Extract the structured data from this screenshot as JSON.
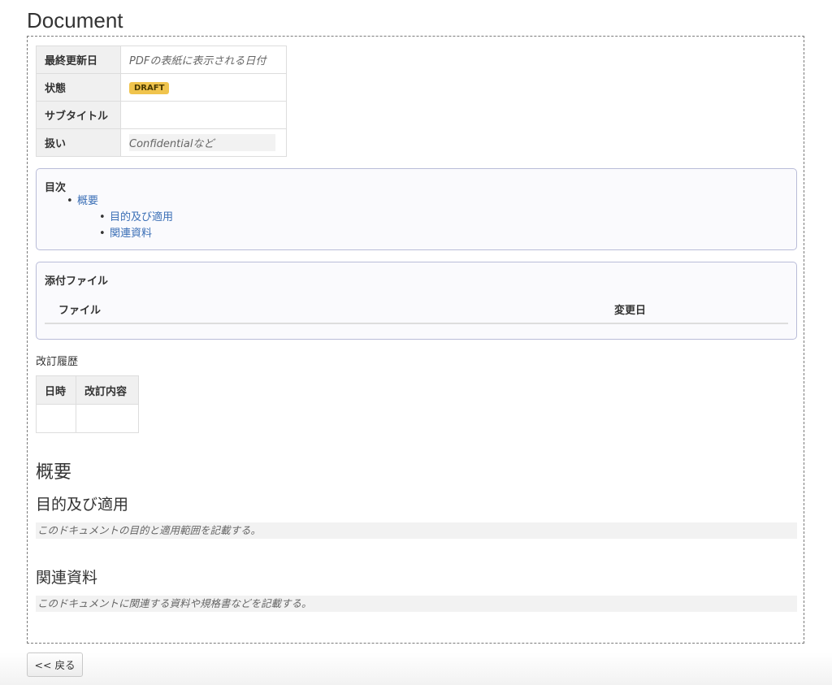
{
  "page": {
    "title": "Document"
  },
  "meta": {
    "rows": [
      {
        "key": "最終更新日",
        "value": "PDFの表紙に表示される日付"
      },
      {
        "key": "状態",
        "value": "DRAFT"
      },
      {
        "key": "サブタイトル",
        "value": ""
      },
      {
        "key": "扱い",
        "value": "Confidentialなど"
      }
    ],
    "badge_color": "#f0c44d"
  },
  "toc": {
    "title": "目次",
    "items": [
      {
        "label": "概要"
      },
      {
        "label": "目的及び適用"
      },
      {
        "label": "関連資料"
      }
    ],
    "link_color": "#3b6fb6"
  },
  "attachments": {
    "title": "添付ファイル",
    "columns": [
      "ファイル",
      "変更日"
    ]
  },
  "revision": {
    "label": "改訂履歴",
    "columns": [
      "日時",
      "改訂内容"
    ]
  },
  "sections": {
    "overview": "概要",
    "purpose": {
      "heading": "目的及び適用",
      "note": "このドキュメントの目的と適用範囲を記載する。"
    },
    "related": {
      "heading": "関連資料",
      "note": "このドキュメントに関連する資料や規格書などを記載する。"
    }
  },
  "back_button": {
    "label": "<< 戻る"
  }
}
